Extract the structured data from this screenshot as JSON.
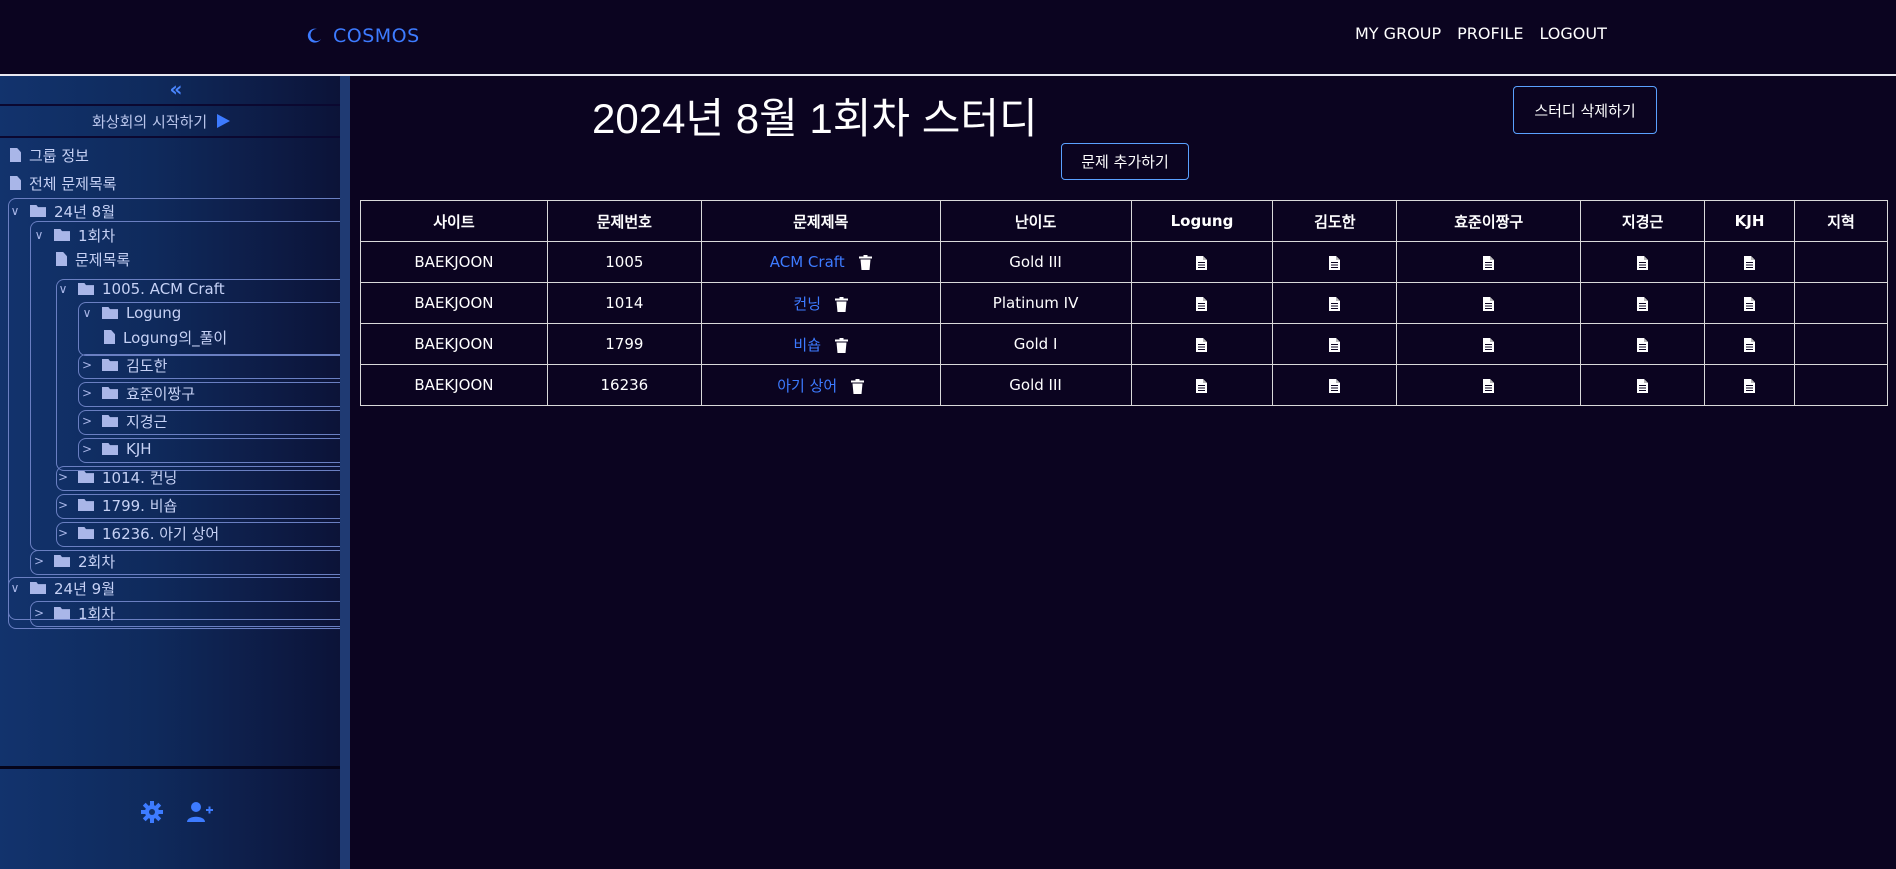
{
  "app": {
    "brand": "COSMOS",
    "nav": [
      "MY GROUP",
      "PROFILE",
      "LOGOUT"
    ]
  },
  "sidebar": {
    "collapse_label": "«",
    "start_call_label": "화상회의 시작하기",
    "items": {
      "group_info": "그룹 정보",
      "all_problems": "전체 문제목록",
      "aug_folder": "24년 8월",
      "round1": "1회차",
      "problem_list": "문제목록",
      "p1005": "1005. ACM Craft",
      "logung": "Logung",
      "logung_solution": "Logung의_풀이",
      "kimdohan": "김도한",
      "hyojun": "효준이짱구",
      "jigyeong": "지경근",
      "kjh": "KJH",
      "p1014": "1014. 컨닝",
      "p1799": "1799. 비숍",
      "p16236": "16236. 아기 상어",
      "round2": "2회차",
      "sep_folder": "24년 9월",
      "sep_round1": "1회차"
    }
  },
  "main": {
    "title": "2024년 8월 1회차 스터디",
    "delete_study_label": "스터디 삭제하기",
    "add_problem_label": "문제 추가하기",
    "table": {
      "headers": [
        "사이트",
        "문제번호",
        "문제제목",
        "난이도",
        "Logung",
        "김도한",
        "효준이짱구",
        "지경근",
        "KJH",
        "지혁"
      ],
      "rows": [
        {
          "site": "BAEKJOON",
          "number": "1005",
          "title": "ACM Craft",
          "difficulty": "Gold III"
        },
        {
          "site": "BAEKJOON",
          "number": "1014",
          "title": "컨닝",
          "difficulty": "Platinum IV"
        },
        {
          "site": "BAEKJOON",
          "number": "1799",
          "title": "비숍",
          "difficulty": "Gold I"
        },
        {
          "site": "BAEKJOON",
          "number": "16236",
          "title": "아기 상어",
          "difficulty": "Gold III"
        }
      ]
    }
  },
  "colors": {
    "background": "#0b0420",
    "accent": "#3d7bff",
    "sidebar_start": "#12336d"
  }
}
